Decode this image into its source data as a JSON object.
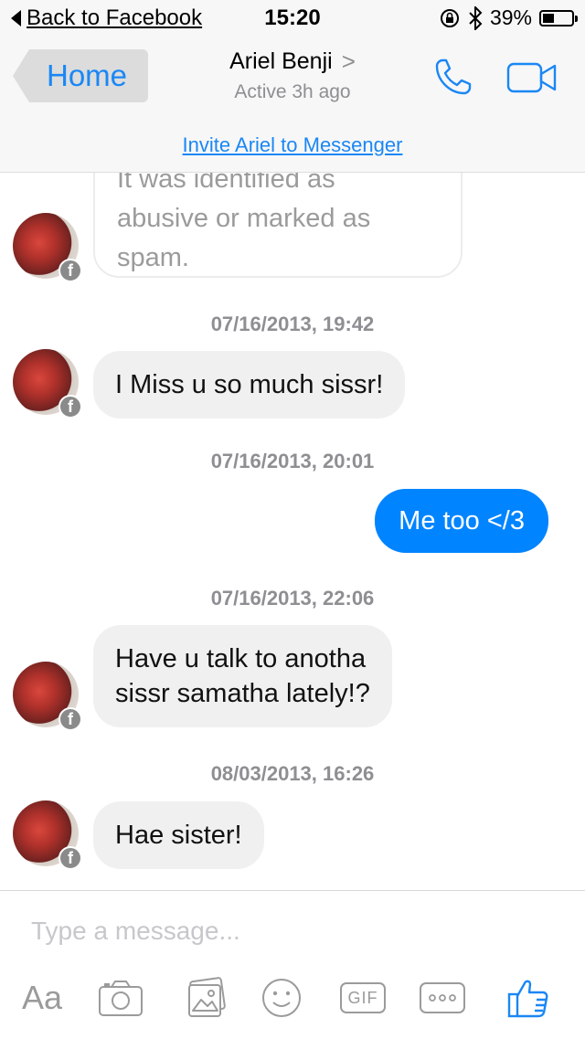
{
  "status_bar": {
    "back_label": "Back to Facebook",
    "time": "15:20",
    "battery": "39%",
    "battery_level": 0.39
  },
  "header": {
    "home_label": "Home",
    "contact_name": "Ariel Benji",
    "contact_chevron": ">",
    "contact_status": "Active 3h ago",
    "icons": [
      "phone-icon",
      "video-call-icon"
    ]
  },
  "invite": {
    "label": "Invite Ariel to Messenger"
  },
  "thread": {
    "system_message_lines": [
      "It was identified as",
      "abusive or marked as",
      "spam."
    ],
    "messages": [
      {
        "timestamp": "07/16/2013, 19:42",
        "direction": "incoming",
        "text": "I Miss u so much sissr!"
      },
      {
        "timestamp": "07/16/2013, 20:01",
        "direction": "outgoing",
        "text": "Me too </3"
      },
      {
        "timestamp": "07/16/2013, 22:06",
        "direction": "incoming",
        "lines": [
          "Have u talk to anotha",
          "sissr samatha lately!?"
        ]
      },
      {
        "timestamp": "08/03/2013, 16:26",
        "direction": "incoming",
        "text": "Hae sister!"
      }
    ],
    "avatar_badge": "f"
  },
  "composer": {
    "placeholder": "Type a message...",
    "aa_label": "Aa",
    "gif_label": "GIF",
    "toolbar_icons": [
      "text-format-icon",
      "camera-icon",
      "photo-gallery-icon",
      "emoji-icon",
      "gif-icon",
      "more-icon",
      "thumbs-up-icon"
    ]
  },
  "colors": {
    "accent": "#1a87f5",
    "outgoing_bubble": "#0084ff",
    "incoming_bubble": "#f1f0f0",
    "muted_text": "#8e8e93"
  }
}
